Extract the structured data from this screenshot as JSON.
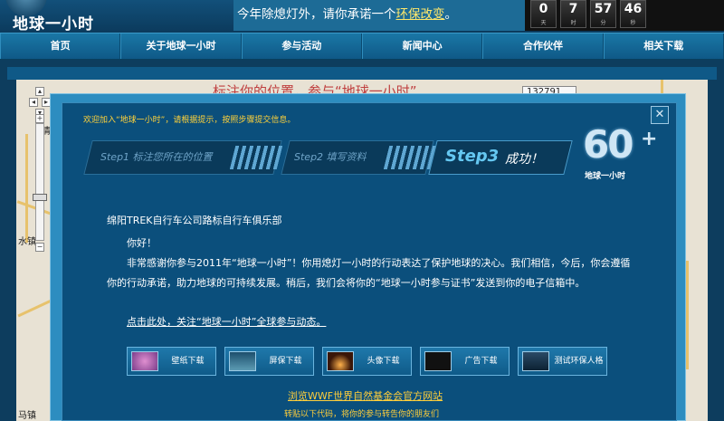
{
  "header": {
    "logo_text": "地球一小时",
    "banner_text": "今年除熄灯外，请你承诺一个",
    "banner_link": "环保改变",
    "banner_end": "。",
    "countdown": [
      {
        "value": "0",
        "unit": "天"
      },
      {
        "value": "7",
        "unit": "时"
      },
      {
        "value": "57",
        "unit": "分"
      },
      {
        "value": "46",
        "unit": "秒"
      }
    ]
  },
  "nav": [
    "首页",
    "关于地球一小时",
    "参与活动",
    "新闻中心",
    "合作伙伴",
    "相关下载"
  ],
  "map": {
    "title": "标注你的位置，参与“地球一小时”",
    "scale": "132791",
    "labels": [
      "水镇",
      "马镇",
      "清"
    ]
  },
  "dialog": {
    "tip": "欢迎加入“地球一小时”，请根据提示，按照步骤提交信息。",
    "close_glyph": "✕",
    "steps": [
      {
        "label": "Step1  标注您所在的位置"
      },
      {
        "label": "Step2  填写资料"
      }
    ],
    "step3": {
      "num": "Step3",
      "text": "成功！"
    },
    "badge": {
      "num": "60",
      "plus": "+",
      "text": "地球一小时"
    },
    "org": "绵阳TREK自行车公司路标自行车俱乐部",
    "greeting": "你好！",
    "body": "非常感谢你参与2011年“地球一小时”！你用熄灯一小时的行动表达了保护地球的决心。我们相信，今后，你会遵循你的行动承诺，助力地球的可持续发展。稍后，我们会将你的“地球一小时参与证书”发送到你的电子信箱中。",
    "follow_link": "点击此处，关注“地球一小时”全球参与动态。",
    "buttons": [
      {
        "label": "壁纸下载",
        "thumb": "wallpaper-icon"
      },
      {
        "label": "屏保下载",
        "thumb": "screensaver-icon"
      },
      {
        "label": "头像下载",
        "thumb": "avatar-icon"
      },
      {
        "label": "广告下载",
        "thumb": "ad-icon"
      },
      {
        "label": "测试环保人格",
        "thumb": "test-icon"
      }
    ],
    "wwf_link": "浏览WWF世界自然基金会官方网站",
    "share_text": "转贴以下代码，将你的参与转告你的朋友们"
  },
  "colors": {
    "accent": "#ffce3a",
    "step_active": "#65c8f2",
    "nav_bg": "#1a77a6"
  }
}
